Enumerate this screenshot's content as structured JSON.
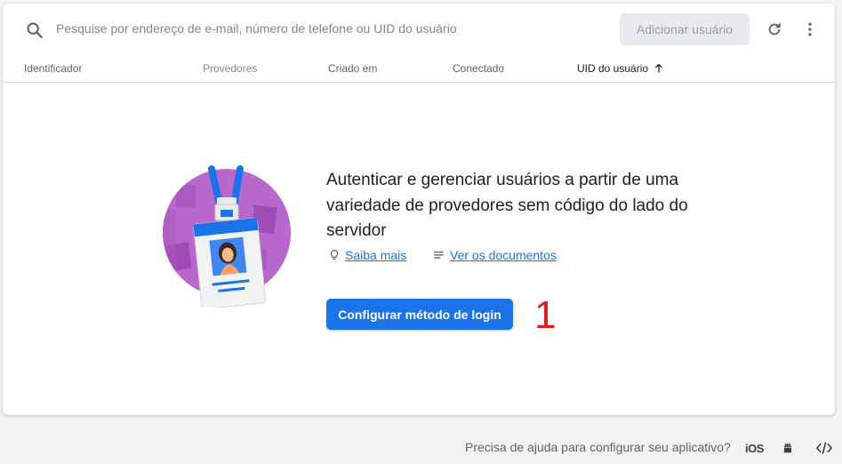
{
  "toolbar": {
    "search_placeholder": "Pesquise por endereço de e-mail, número de telefone ou UID do usuário",
    "add_user_label": "Adicionar usuário",
    "icons": [
      "search-icon",
      "refresh-icon",
      "more-vert-icon"
    ]
  },
  "table": {
    "columns": [
      {
        "label": "Identificador",
        "state": "normal"
      },
      {
        "label": "Provedores",
        "state": "muted"
      },
      {
        "label": "Criado em",
        "state": "normal"
      },
      {
        "label": "Conectado",
        "state": "normal"
      },
      {
        "label": "UID do usuário",
        "state": "sorted-ascending"
      }
    ]
  },
  "empty_state": {
    "headline": "Autenticar e gerenciar usuários a partir de uma variedade de provedores sem código do lado do servidor",
    "learn_more": "Saiba mais",
    "docs": "Ver os documentos",
    "cta": "Configurar método de login",
    "step_marker": "1"
  },
  "footer": {
    "help_text": "Precisa de ajuda para configurar seu aplicativo?",
    "ios_label": "iOS",
    "platform_icons": [
      "ios-icon",
      "android-icon",
      "code-icon"
    ]
  },
  "colors": {
    "accent": "#1a73e8",
    "step_marker": "#e01b1b",
    "illustration_purple": "#b868cc"
  }
}
